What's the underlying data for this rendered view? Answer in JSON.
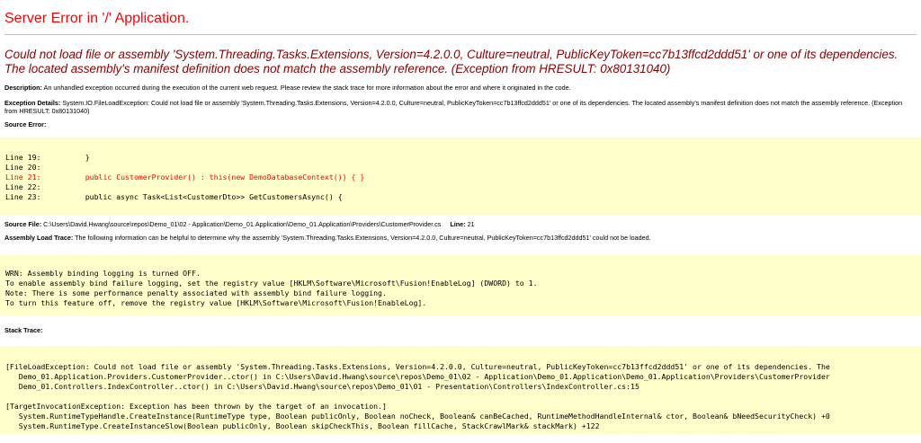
{
  "title": "Server Error in '/' Application.",
  "error_message": "Could not load file or assembly 'System.Threading.Tasks.Extensions, Version=4.2.0.0, Culture=neutral, PublicKeyToken=cc7b13ffcd2ddd51' or one of its dependencies. The located assembly's manifest definition does not match the assembly reference. (Exception from HRESULT: 0x80131040)",
  "description": {
    "label": "Description:",
    "text": "An unhandled exception occurred during the execution of the current web request. Please review the stack trace for more information about the error and where it originated in the code."
  },
  "exception_details": {
    "label": "Exception Details:",
    "text": "System.IO.FileLoadException: Could not load file or assembly 'System.Threading.Tasks.Extensions, Version=4.2.0.0, Culture=neutral, PublicKeyToken=cc7b13ffcd2ddd51' or one of its dependencies. The located assembly's manifest definition does not match the assembly reference. (Exception from HRESULT: 0x80131040)"
  },
  "source_error": {
    "label": "Source Error:",
    "lines": [
      {
        "num": "Line 19:",
        "code": "        }"
      },
      {
        "num": "Line 20:",
        "code": ""
      },
      {
        "num": "Line 21:",
        "code": "        public CustomerProvider() : this(new DemoDatabaseContext()) { }"
      },
      {
        "num": "Line 22:",
        "code": ""
      },
      {
        "num": "Line 23:",
        "code": "        public async Task<List<CustomerDto>> GetCustomersAsync() {"
      }
    ]
  },
  "source_file": {
    "label": "Source File:",
    "path": "C:\\Users\\David.Hwang\\source\\repos\\Demo_01\\02 - Application\\Demo_01.Application\\Demo_01.Application\\Providers\\CustomerProvider.cs",
    "line_label": "Line:",
    "line_value": "21"
  },
  "assembly_load_trace": {
    "label": "Assembly Load Trace:",
    "text": "The following information can be helpful to determine why the assembly 'System.Threading.Tasks.Extensions, Version=4.2.0.0, Culture=neutral, PublicKeyToken=cc7b13ffcd2ddd51' could not be loaded.",
    "lines": [
      "WRN: Assembly binding logging is turned OFF.",
      "To enable assembly bind failure logging, set the registry value [HKLM\\Software\\Microsoft\\Fusion!EnableLog] (DWORD) to 1.",
      "Note: There is some performance penalty associated with assembly bind failure logging.",
      "To turn this feature off, remove the registry value [HKLM\\Software\\Microsoft\\Fusion!EnableLog]."
    ]
  },
  "stack_trace": {
    "label": "Stack Trace:",
    "lines": [
      "[FileLoadException: Could not load file or assembly 'System.Threading.Tasks.Extensions, Version=4.2.0.0, Culture=neutral, PublicKeyToken=cc7b13ffcd2ddd51' or one of its dependencies. The",
      "   Demo_01.Application.Providers.CustomerProvider..ctor() in C:\\Users\\David.Hwang\\source\\repos\\Demo_01\\02 - Application\\Demo_01.Application\\Demo_01.Application\\Providers\\CustomerProvider",
      "   Demo_01.Controllers.IndexController..ctor() in C:\\Users\\David.Hwang\\source\\repos\\Demo_01\\01 - Presentation\\Controllers\\IndexController.cs:15",
      "",
      "[TargetInvocationException: Exception has been thrown by the target of an invocation.]",
      "   System.RuntimeTypeHandle.CreateInstance(RuntimeType type, Boolean publicOnly, Boolean noCheck, Boolean& canBeCached, RuntimeMethodHandleInternal& ctor, Boolean& bNeedSecurityCheck) +0",
      "   System.RuntimeType.CreateInstanceSlow(Boolean publicOnly, Boolean skipCheckThis, Boolean fillCache, StackCrawlMark& stackMark) +122"
    ]
  }
}
